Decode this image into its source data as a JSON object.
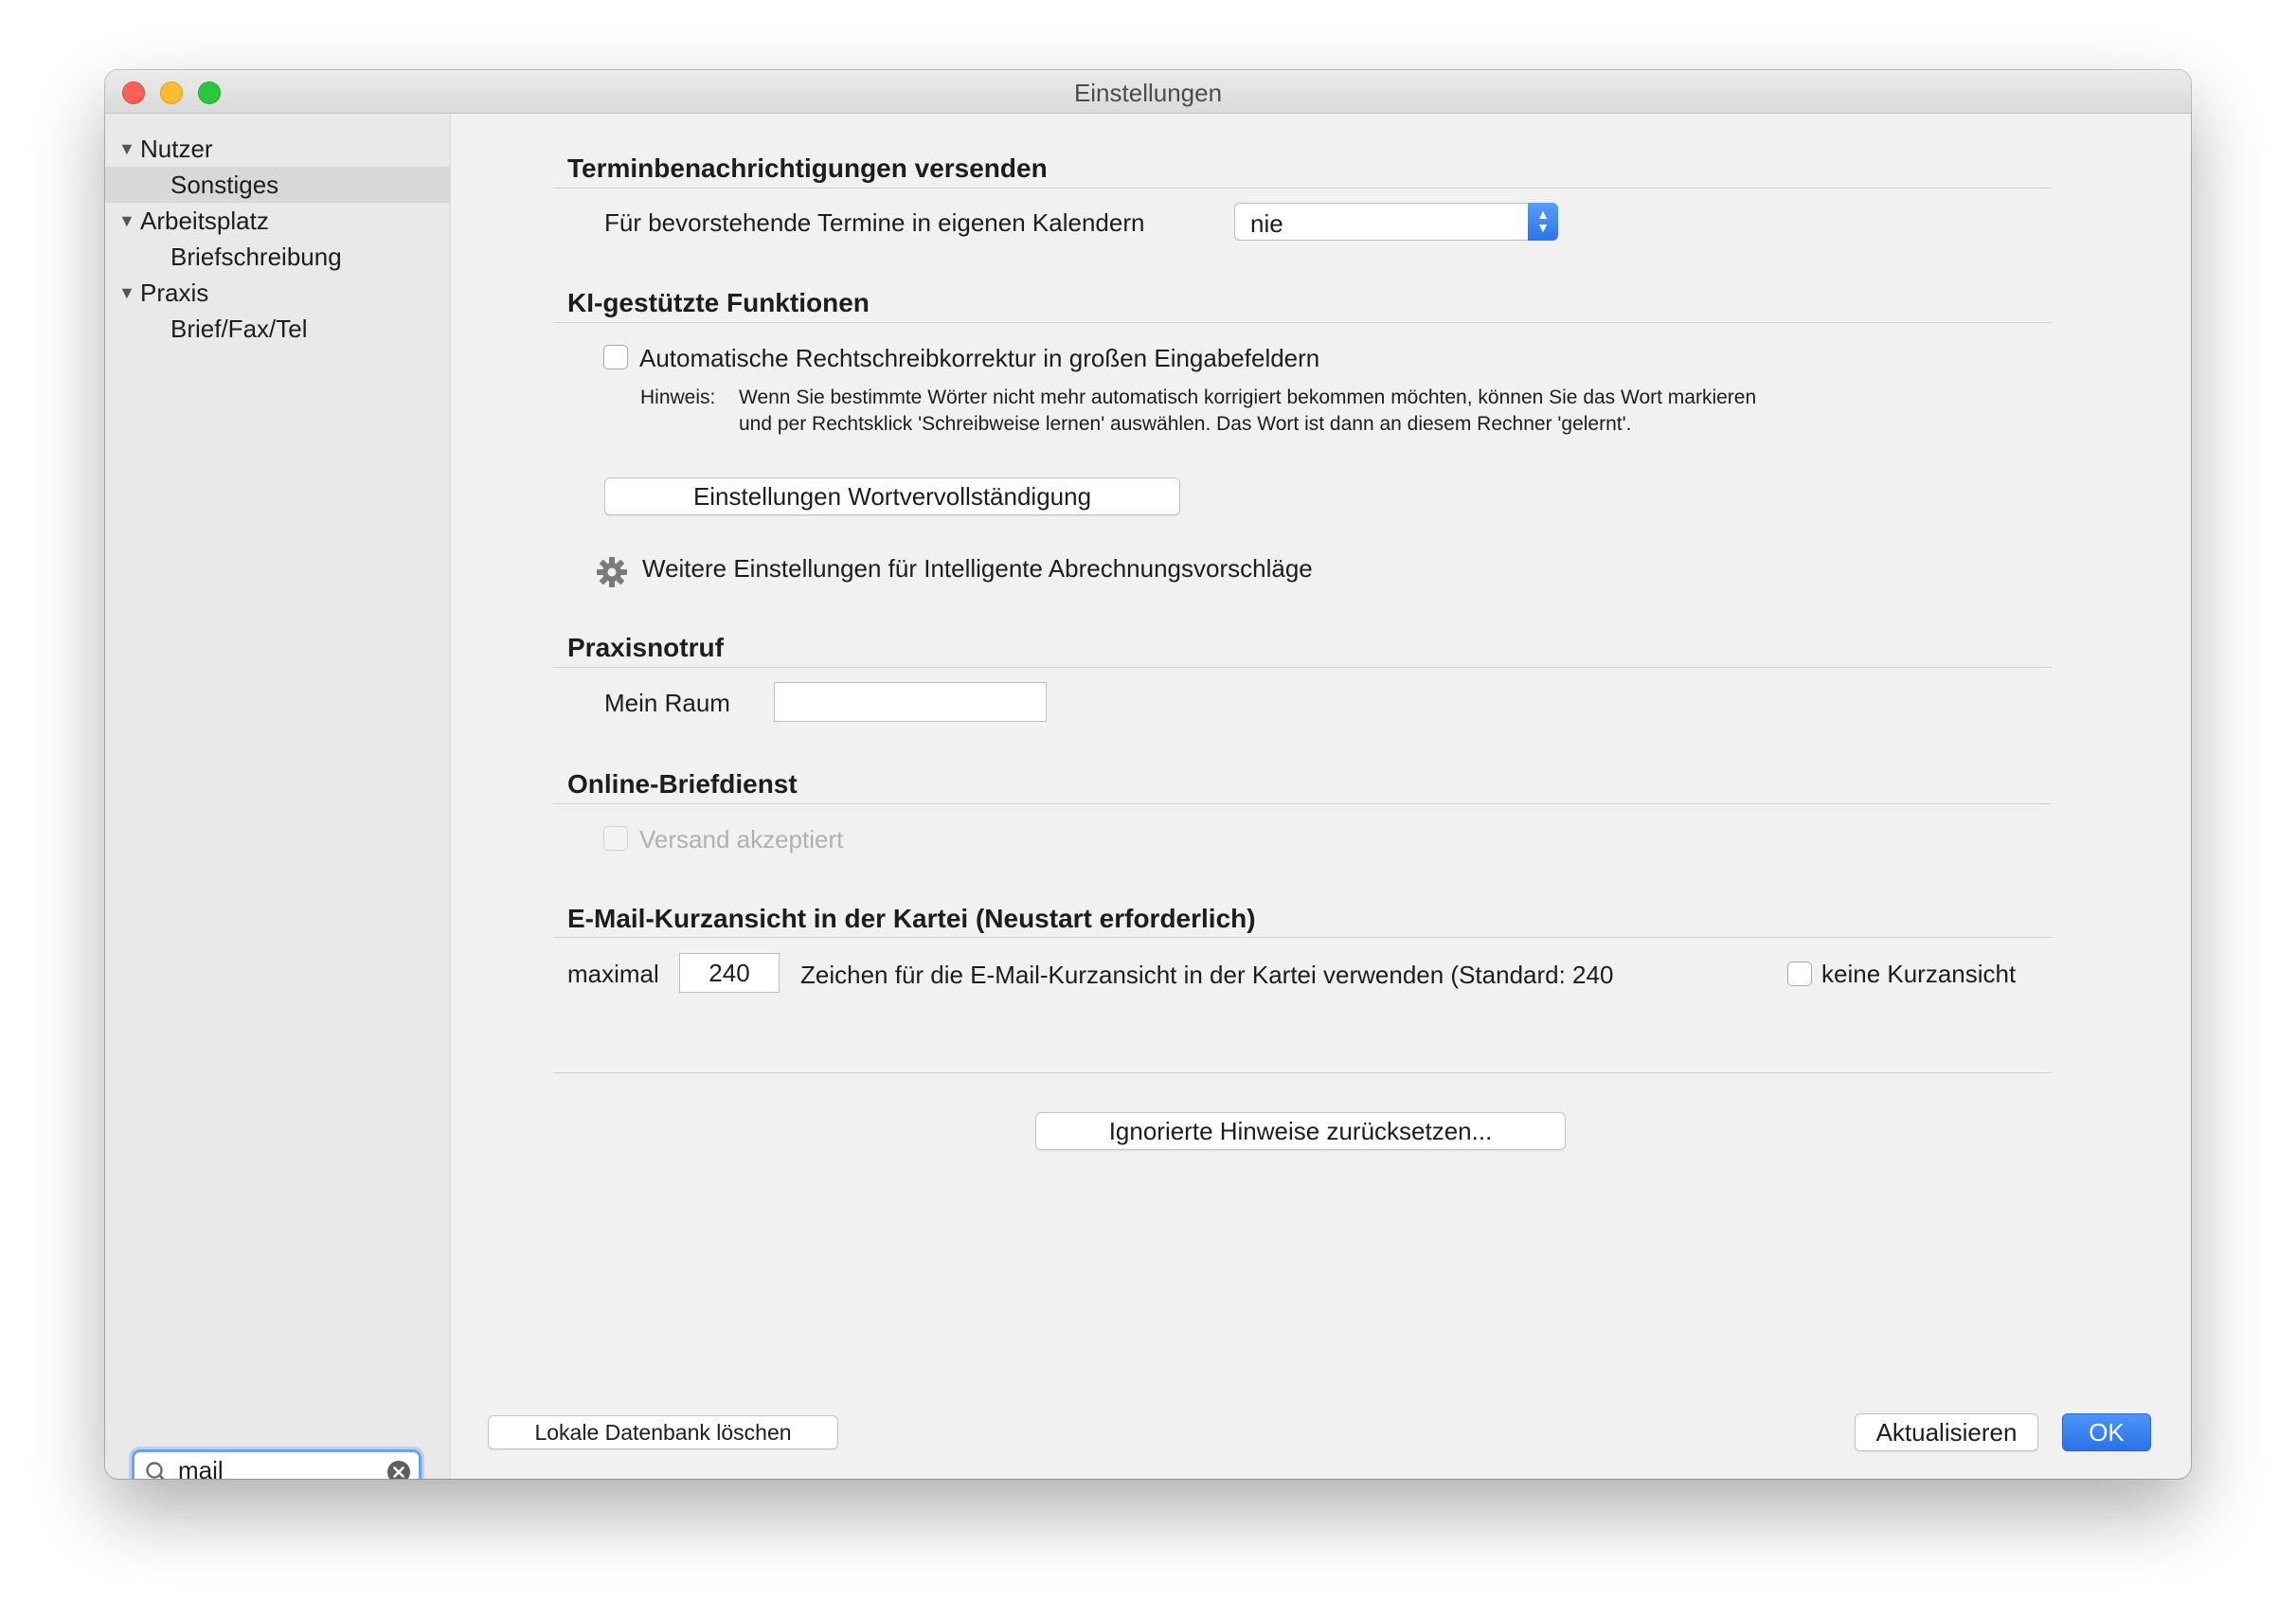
{
  "window": {
    "title": "Einstellungen"
  },
  "sidebar": {
    "items": [
      {
        "label": "Nutzer",
        "level": 0,
        "expanded": true,
        "selected": false
      },
      {
        "label": "Sonstiges",
        "level": 1,
        "selected": true
      },
      {
        "label": "Arbeitsplatz",
        "level": 0,
        "expanded": true,
        "selected": false
      },
      {
        "label": "Briefschreibung",
        "level": 1,
        "selected": false
      },
      {
        "label": "Praxis",
        "level": 0,
        "expanded": true,
        "selected": false
      },
      {
        "label": "Brief/Fax/Tel",
        "level": 1,
        "selected": false
      }
    ],
    "search": {
      "value": "mail",
      "icon": "search-icon",
      "clear_icon": "clear-circle-icon"
    }
  },
  "sections": {
    "appointments": {
      "title": "Terminbenachrichtigungen versenden",
      "label": "Für bevorstehende Termine in eigenen Kalendern",
      "select_value": "nie"
    },
    "ai": {
      "title": "KI-gestützte Funktionen",
      "autocorrect_label": "Automatische Rechtschreibkorrektur in großen Eingabefeldern",
      "autocorrect_checked": false,
      "hint_label": "Hinweis:",
      "hint_line1": "Wenn Sie bestimmte Wörter nicht mehr automatisch korrigiert bekommen möchten, können Sie das Wort markieren",
      "hint_line2": "und per Rechtsklick 'Schreibweise lernen' auswählen. Das Wort ist dann an diesem Rechner 'gelernt'.",
      "completion_button": "Einstellungen Wortvervollständigung",
      "billing_link": "Weitere Einstellungen für Intelligente Abrechnungsvorschläge"
    },
    "emergency": {
      "title": "Praxisnotruf",
      "room_label": "Mein Raum",
      "room_value": ""
    },
    "letter_service": {
      "title": "Online-Briefdienst",
      "accepted_label": "Versand akzeptiert",
      "accepted_checked": false,
      "disabled": true
    },
    "email_preview": {
      "title": "E-Mail-Kurzansicht in der Kartei (Neustart erforderlich)",
      "prefix": "maximal",
      "value": "240",
      "suffix": "Zeichen für die E-Mail-Kurzansicht in der Kartei verwenden (Standard: 240",
      "no_preview_label": "keine Kurzansicht",
      "no_preview_checked": false
    }
  },
  "buttons": {
    "reset_hints": "Ignorierte Hinweise zurücksetzen...",
    "delete_db": "Lokale Datenbank löschen",
    "refresh": "Aktualisieren",
    "ok": "OK"
  },
  "colors": {
    "accent": "#2c74ea",
    "close": "#fc5f57",
    "minimize": "#fdbc2e",
    "maximize": "#29c840"
  }
}
